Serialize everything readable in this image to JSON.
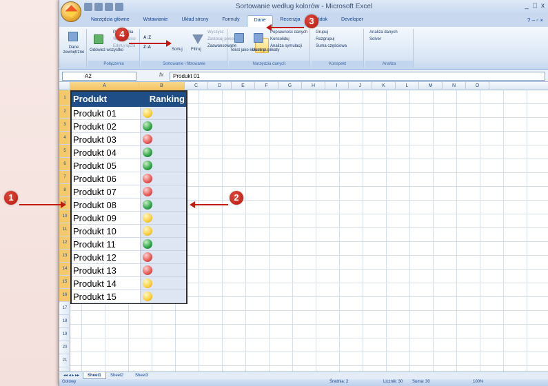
{
  "window": {
    "title": "Sortowanie według kolorów - Microsoft Excel",
    "controls": [
      "_",
      "□",
      "x"
    ]
  },
  "tabs": [
    {
      "label": "Narzędzia główne"
    },
    {
      "label": "Wstawianie"
    },
    {
      "label": "Układ strony"
    },
    {
      "label": "Formuły"
    },
    {
      "label": "Dane"
    },
    {
      "label": "Recenzja"
    },
    {
      "label": "Widok"
    },
    {
      "label": "Developer"
    }
  ],
  "ribbon": {
    "groups": {
      "external": "Dane zewnętrzne",
      "connections": "Połączenia",
      "sort_filter": "Sortowanie i filtrowanie",
      "data_tools": "Narzędzia danych",
      "outline": "Konspekt",
      "analysis": "Analiza"
    },
    "buttons": {
      "external_data": "Dane zewnętrzne",
      "refresh_all": "Odśwież wszystko",
      "connections": "Połączenia",
      "properties": "Właściwości",
      "edit_links": "Edytuj łącza",
      "sort": "Sortuj",
      "filter": "Filtruj",
      "clear": "Wyczyść",
      "reapply": "Zastosuj ponownie",
      "advanced": "Zaawansowane",
      "text_to_columns": "Tekst jako kolumny",
      "remove_duplicates": "Usuń duplikaty",
      "data_validation": "Poprawność danych",
      "consolidate": "Konsoliduj",
      "whatif": "Analiza symulacji",
      "group": "Grupuj",
      "ungroup": "Rozgrupuj",
      "subtotal": "Suma częściowa",
      "data_analysis": "Analiza danych",
      "solver": "Solver"
    }
  },
  "formula_bar": {
    "name_box": "A2",
    "fx": "fx",
    "value": "Produkt 01"
  },
  "columns": [
    "A",
    "B",
    "C",
    "D",
    "E",
    "F",
    "G",
    "H",
    "I",
    "J",
    "K",
    "L",
    "M",
    "N",
    "O"
  ],
  "rows": [
    "1",
    "2",
    "3",
    "4",
    "5",
    "6",
    "7",
    "8",
    "9",
    "10",
    "11",
    "12",
    "13",
    "14",
    "15",
    "16",
    "17",
    "18",
    "19",
    "20",
    "21"
  ],
  "table": {
    "headers": [
      "Produkt",
      "Ranking"
    ],
    "rows": [
      {
        "name": "Produkt 01",
        "rank": "yellow"
      },
      {
        "name": "Produkt 02",
        "rank": "green"
      },
      {
        "name": "Produkt 03",
        "rank": "red"
      },
      {
        "name": "Produkt 04",
        "rank": "green"
      },
      {
        "name": "Produkt 05",
        "rank": "green"
      },
      {
        "name": "Produkt 06",
        "rank": "red"
      },
      {
        "name": "Produkt 07",
        "rank": "red"
      },
      {
        "name": "Produkt 08",
        "rank": "green"
      },
      {
        "name": "Produkt 09",
        "rank": "yellow"
      },
      {
        "name": "Produkt 10",
        "rank": "yellow"
      },
      {
        "name": "Produkt 11",
        "rank": "green"
      },
      {
        "name": "Produkt 12",
        "rank": "red"
      },
      {
        "name": "Produkt 13",
        "rank": "red"
      },
      {
        "name": "Produkt 14",
        "rank": "yellow"
      },
      {
        "name": "Produkt 15",
        "rank": "yellow"
      }
    ]
  },
  "sheets": [
    "Sheet1",
    "Sheet2",
    "Sheet3"
  ],
  "status": {
    "ready": "Gotowy",
    "average": "Średnia: 2",
    "count": "Licznik: 30",
    "sum": "Suma: 30",
    "zoom": "100%"
  },
  "callouts": [
    "1",
    "2",
    "3",
    "4"
  ],
  "colors": {
    "header_bg": "#1f4e87",
    "callout": "#c21a10",
    "ribbon": "#dbe7f6"
  }
}
